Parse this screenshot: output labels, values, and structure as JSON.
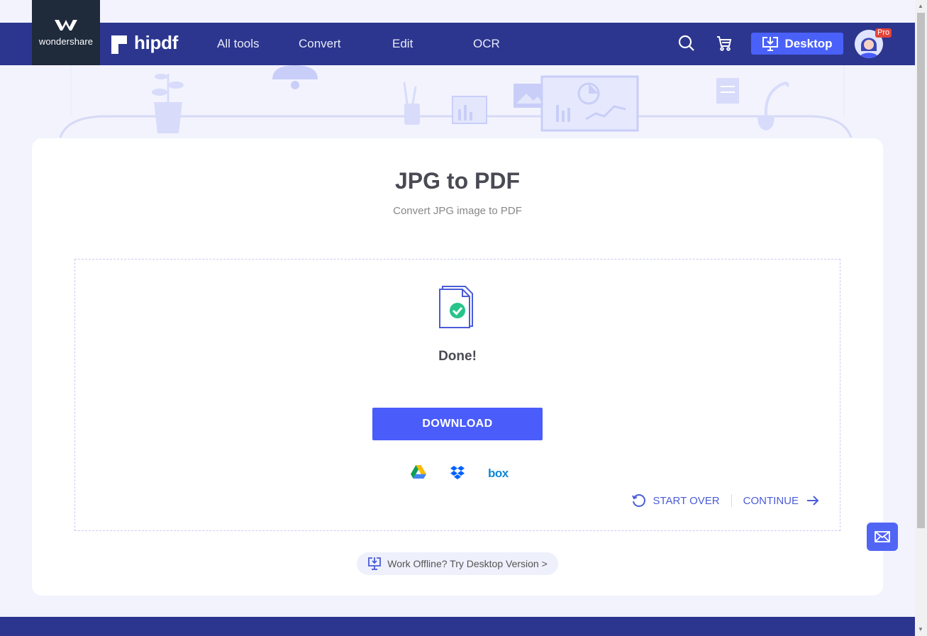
{
  "brand": {
    "wondershare": "wondershare",
    "hipdf": "hipdf"
  },
  "nav": {
    "items": [
      "All tools",
      "Convert",
      "Edit",
      "OCR"
    ],
    "desktop_label": "Desktop",
    "pro_badge": "Pro"
  },
  "main": {
    "title": "JPG to PDF",
    "subtitle": "Convert JPG image to PDF",
    "status": "Done!",
    "download_label": "DOWNLOAD",
    "cloud_services": [
      "google-drive-icon",
      "dropbox-icon",
      "box-icon"
    ],
    "box_label": "box",
    "start_over_label": "START OVER",
    "continue_label": "CONTINUE",
    "offline_text": "Work Offline? Try Desktop Version >"
  },
  "colors": {
    "navbar": "#2c368f",
    "accent": "#4a5cfa",
    "success": "#27c48a",
    "page_bg": "#f2f3fd"
  }
}
